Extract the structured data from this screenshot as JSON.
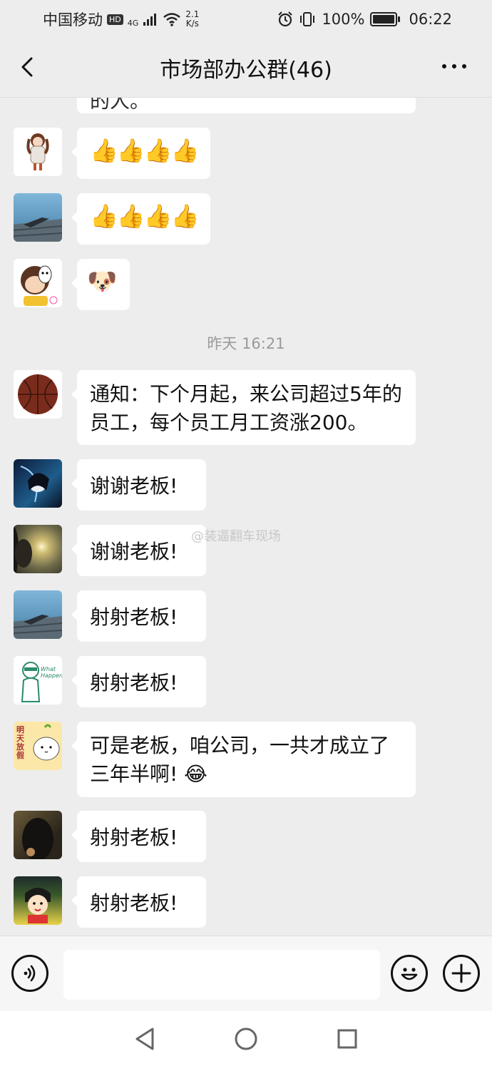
{
  "status_bar": {
    "carrier": "中国移动",
    "hd": "HD",
    "network": "4G",
    "speed_value": "2.1",
    "speed_unit": "K/s",
    "battery": "100%",
    "time": "06:22",
    "battery_level": 1.0
  },
  "header": {
    "title": "市场部办公群(46)"
  },
  "chat": {
    "partial_top_text": "的人。",
    "messages": [
      {
        "text": "👍👍👍👍",
        "avatar": "girl-doll-avatar"
      },
      {
        "text": "👍👍👍👍",
        "avatar": "lying-on-dock-avatar"
      },
      {
        "text": "🐶",
        "avatar": "cartoon-mask-avatar"
      },
      {
        "text": "通知：下个月起，来公司超过5年的员工，每个员工月工资涨200。",
        "avatar": "basketball-avatar"
      },
      {
        "text": "谢谢老板!",
        "avatar": "anime-dark-avatar"
      },
      {
        "text": "谢谢老板!",
        "avatar": "sunset-avatar"
      },
      {
        "text": "射射老板!",
        "avatar": "lying-on-dock-avatar"
      },
      {
        "text": "射射老板!",
        "avatar": "sketch-what-happened-avatar"
      },
      {
        "text": "可是老板，咱公司，一共才成立了三年半啊! 😂",
        "avatar": "cat-sticker-avatar"
      },
      {
        "text": "射射老板!",
        "avatar": "dark-photo-avatar"
      },
      {
        "text": "射射老板!",
        "avatar": "chibi-maruko-avatar"
      }
    ],
    "time_divider": "昨天 16:21",
    "watermark": "@装逼翻车现场",
    "avatar_sticker_text": "明天放假",
    "avatar_sketch_text": "What Happened?"
  },
  "input_bar": {
    "voice_icon": "voice-icon",
    "emoji_icon": "emoji-icon",
    "plus_icon": "plus-icon"
  },
  "system_nav": {
    "back_icon": "triangle-back-icon",
    "home_icon": "circle-home-icon",
    "recent_icon": "square-recent-icon"
  },
  "colors": {
    "background": "#ededed",
    "bubble": "#ffffff",
    "text": "#111111",
    "time": "#9a9a9a"
  }
}
